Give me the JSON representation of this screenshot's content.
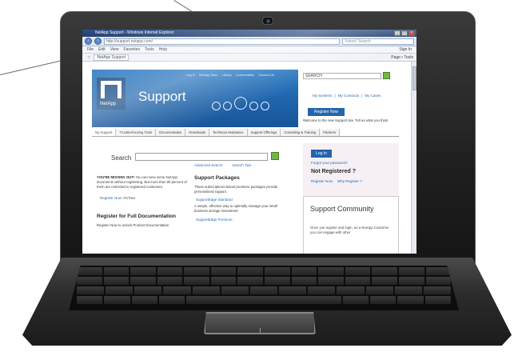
{
  "browser": {
    "window_title": "NetApp Support - Windows Internet Explorer",
    "url": "http://support.netapp.com/",
    "search_placeholder": "Yahoo! Search",
    "menu": [
      "File",
      "Edit",
      "View",
      "Favorites",
      "Tools",
      "Help"
    ],
    "tab_title": "NetApp Support",
    "sign_in": "Sign In",
    "command": "Page • Tools"
  },
  "site": {
    "logo_text": "NetApp",
    "title": "Support",
    "top_links": [
      "Log In",
      "NetApp Sites",
      "Library",
      "Communities",
      "Contact Us"
    ],
    "search_value": "SEARCH",
    "account_links": [
      "My Systems",
      "My Contracts",
      "My Cases"
    ],
    "register_button": "Register Now",
    "welcome": "Welcome to the new Support site.  Tell us what you think",
    "tabs": [
      "My Support",
      "Troubleshooting Tools",
      "Documentation",
      "Downloads",
      "Technical Assistance",
      "Support Offerings",
      "Consulting & Training",
      "Partners"
    ]
  },
  "main": {
    "search_label": "Search",
    "advanced_search": "Advanced Search",
    "search_tips": "Search Tips",
    "missing_out_bold": "YOU'RE MISSING OUT!",
    "missing_out_text": " You can view some NetApp documents without registering. But more than 80 percent of them are restricted to registered customers.",
    "register_now_link": "Register Now.",
    "its_free": "It's free.",
    "register_full_title": "Register for Full Documentation",
    "register_full_sub": "Register Now to unlock Product Documentation",
    "packages_title": "Support Packages",
    "packages_desc": "These subscriptions-based premiere packages provide personalized support.",
    "standard_link": "SupportEdge Standard",
    "standard_desc": "A simple, effective way to optimally manage your small business storage investment.",
    "premium_link": "SupportEdge Premium"
  },
  "login": {
    "login_button": "Log In",
    "forgot": "Forgot your password?",
    "not_registered": "Not Registered ?",
    "register_now": "Register Now",
    "why_register": "Why Register ?"
  },
  "community": {
    "title": "Support Community",
    "text": "Once you register and login, as a NetApp Customer you can engage with other"
  }
}
